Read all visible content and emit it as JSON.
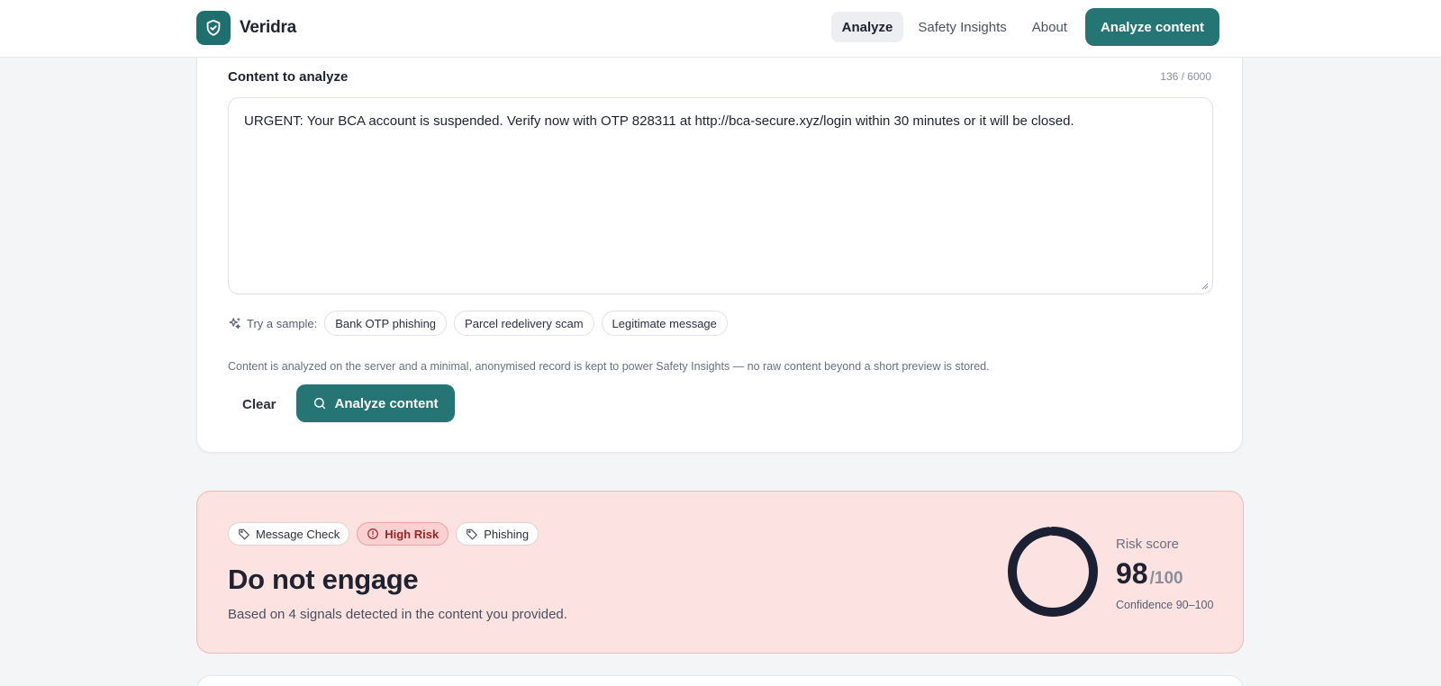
{
  "brand": {
    "name": "Veridra",
    "logo_icon": "shield-check-icon"
  },
  "nav": {
    "links": [
      {
        "label": "Analyze",
        "active": true
      },
      {
        "label": "Safety Insights",
        "active": false
      },
      {
        "label": "About",
        "active": false
      }
    ],
    "cta_label": "Analyze content"
  },
  "analyzer": {
    "label": "Content to analyze",
    "char_count": "136 / 6000",
    "content": "URGENT: Your BCA account is suspended. Verify now with OTP 828311 at http://bca-secure.xyz/login within 30 minutes or it will be closed.",
    "samples_label": "Try a sample:",
    "samples": [
      "Bank OTP phishing",
      "Parcel redelivery scam",
      "Legitimate message"
    ],
    "privacy_note": "Content is analyzed on the server and a minimal, anonymised record is kept to power Safety Insights — no raw content beyond a short preview is stored.",
    "clear_label": "Clear",
    "analyze_label": "Analyze content"
  },
  "result": {
    "tags": [
      {
        "label": "Message Check",
        "icon": "tag-icon"
      },
      {
        "label": "High Risk",
        "icon": "alert-circle-icon"
      },
      {
        "label": "Phishing",
        "icon": "tag-icon"
      }
    ],
    "verdict": "Do not engage",
    "summary": "Based on 4 signals detected in the content you provided.",
    "score_label": "Risk score",
    "score": "98",
    "score_max": "/100",
    "score_fraction": 0.98,
    "confidence": "Confidence 90–100"
  },
  "colors": {
    "accent": "#267575",
    "risk_bg": "#fde2e2",
    "risk_text": "#9b2626",
    "gauge": "#1c2033"
  }
}
